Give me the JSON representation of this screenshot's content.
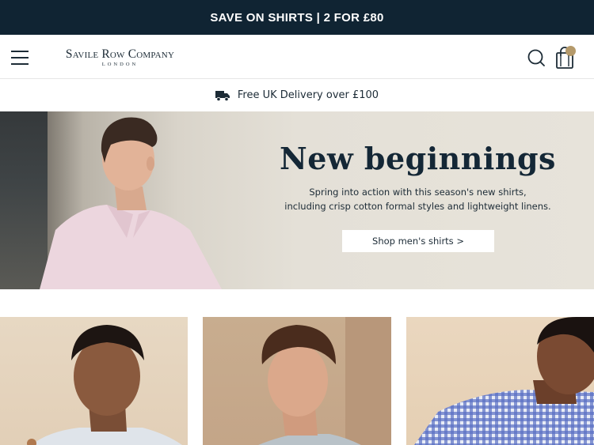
{
  "promo": {
    "text": "SAVE ON SHIRTS | 2 FOR £80"
  },
  "header": {
    "logo_main": "Savile Row Company",
    "logo_sub": "LONDON",
    "icons": [
      "menu-icon",
      "search-icon",
      "shopping-bag-icon"
    ],
    "cart_badge_color": "#b59a6b"
  },
  "delivery": {
    "text": "Free UK Delivery over £100",
    "icon": "truck-icon"
  },
  "hero": {
    "title": "New beginnings",
    "subtitle_line1": "Spring into action with this season's new shirts,",
    "subtitle_line2": "including crisp cotton formal styles and lightweight linens.",
    "cta": "Shop men's shirts >"
  },
  "colors": {
    "promo_bg": "#102433",
    "text_primary": "#1c2b36",
    "hero_bg": "#e4e0d7",
    "accent": "#b59a6b"
  }
}
